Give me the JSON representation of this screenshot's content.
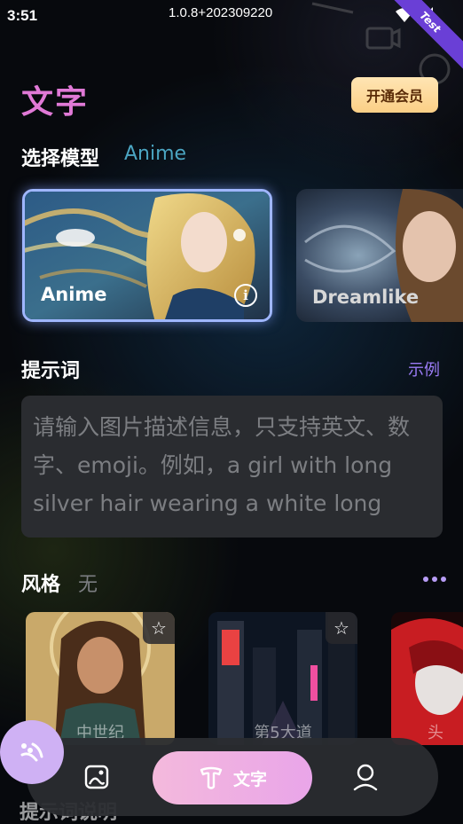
{
  "status_bar": {
    "time": "3:51",
    "build": "1.0.8+202309220",
    "ribbon": "Test"
  },
  "header": {
    "title": "文字",
    "vip_button": "开通会员"
  },
  "model_section": {
    "heading": "选择模型",
    "selected": "Anime",
    "models": [
      {
        "label": "Anime",
        "selected": true
      },
      {
        "label": "Dreamlike",
        "selected": false
      }
    ]
  },
  "prompt_section": {
    "heading": "提示词",
    "example_link": "示例",
    "placeholder": "请输入图片描述信息，只支持英文、数字、emoji。例如，a girl with long silver hair wearing a white long"
  },
  "style_section": {
    "heading": "风格",
    "value": "无",
    "styles": [
      {
        "label": "中世纪"
      },
      {
        "label": "第5大道"
      },
      {
        "label": "头"
      }
    ]
  },
  "bottom_nav": {
    "items": [
      {
        "label": "",
        "icon": "image-icon"
      },
      {
        "label": "文字",
        "icon": "text-icon",
        "active": true
      },
      {
        "label": "",
        "icon": "profile-icon"
      }
    ]
  },
  "partial_heading": "提示词说明",
  "colors": {
    "title": "#e079d6",
    "accent_model": "#4ba5c2",
    "link": "#9b7cf6",
    "vip_bg": "#fbcf86",
    "nav_active": "#f4b9dc",
    "fab": "#cfb1f4"
  }
}
